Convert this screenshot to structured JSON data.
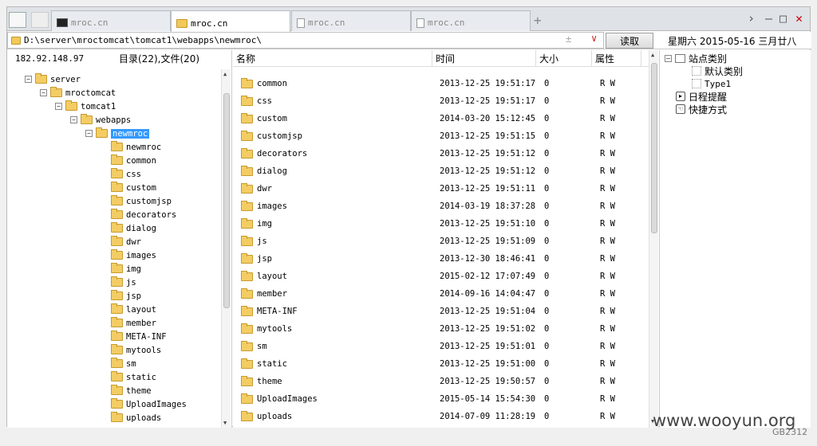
{
  "tabs": [
    {
      "label": "mroc.cn",
      "icon": "terminal-icon",
      "active": false
    },
    {
      "label": "mroc.cn",
      "icon": "folder-icon",
      "active": true
    },
    {
      "label": "mroc.cn",
      "icon": "document-icon",
      "active": false
    },
    {
      "label": "mroc.cn",
      "icon": "document-icon",
      "active": false
    }
  ],
  "address": {
    "path": "D:\\server\\mroctomcat\\tomcat1\\webapps\\newmroc\\",
    "read_label": "读取",
    "date": "星期六 2015-05-16 三月廿八"
  },
  "left": {
    "ip": "182.92.148.97",
    "counts": "目录(22),文件(20)",
    "tree": [
      {
        "label": "server",
        "level": 0,
        "expander": "−"
      },
      {
        "label": "mroctomcat",
        "level": 1,
        "expander": "−"
      },
      {
        "label": "tomcat1",
        "level": 2,
        "expander": "−"
      },
      {
        "label": "webapps",
        "level": 3,
        "expander": "−"
      },
      {
        "label": "newmroc",
        "level": 4,
        "expander": "−",
        "selected": true
      },
      {
        "label": "newmroc",
        "level": 5
      },
      {
        "label": "common",
        "level": 5
      },
      {
        "label": "css",
        "level": 5
      },
      {
        "label": "custom",
        "level": 5
      },
      {
        "label": "customjsp",
        "level": 5
      },
      {
        "label": "decorators",
        "level": 5
      },
      {
        "label": "dialog",
        "level": 5
      },
      {
        "label": "dwr",
        "level": 5
      },
      {
        "label": "images",
        "level": 5
      },
      {
        "label": "img",
        "level": 5
      },
      {
        "label": "js",
        "level": 5
      },
      {
        "label": "jsp",
        "level": 5
      },
      {
        "label": "layout",
        "level": 5
      },
      {
        "label": "member",
        "level": 5
      },
      {
        "label": "META-INF",
        "level": 5
      },
      {
        "label": "mytools",
        "level": 5
      },
      {
        "label": "sm",
        "level": 5
      },
      {
        "label": "static",
        "level": 5
      },
      {
        "label": "theme",
        "level": 5
      },
      {
        "label": "UploadImages",
        "level": 5
      },
      {
        "label": "uploads",
        "level": 5
      }
    ]
  },
  "files": {
    "headers": {
      "name": "名称",
      "time": "时间",
      "size": "大小",
      "attr": "属性"
    },
    "rows": [
      {
        "name": "common",
        "time": "2013-12-25 19:51:17",
        "size": "0",
        "attr": "R W"
      },
      {
        "name": "css",
        "time": "2013-12-25 19:51:17",
        "size": "0",
        "attr": "R W"
      },
      {
        "name": "custom",
        "time": "2014-03-20 15:12:45",
        "size": "0",
        "attr": "R W"
      },
      {
        "name": "customjsp",
        "time": "2013-12-25 19:51:15",
        "size": "0",
        "attr": "R W"
      },
      {
        "name": "decorators",
        "time": "2013-12-25 19:51:12",
        "size": "0",
        "attr": "R W"
      },
      {
        "name": "dialog",
        "time": "2013-12-25 19:51:12",
        "size": "0",
        "attr": "R W"
      },
      {
        "name": "dwr",
        "time": "2013-12-25 19:51:11",
        "size": "0",
        "attr": "R W"
      },
      {
        "name": "images",
        "time": "2014-03-19 18:37:28",
        "size": "0",
        "attr": "R W"
      },
      {
        "name": "img",
        "time": "2013-12-25 19:51:10",
        "size": "0",
        "attr": "R W"
      },
      {
        "name": "js",
        "time": "2013-12-25 19:51:09",
        "size": "0",
        "attr": "R W"
      },
      {
        "name": "jsp",
        "time": "2013-12-30 18:46:41",
        "size": "0",
        "attr": "R W"
      },
      {
        "name": "layout",
        "time": "2015-02-12 17:07:49",
        "size": "0",
        "attr": "R W"
      },
      {
        "name": "member",
        "time": "2014-09-16 14:04:47",
        "size": "0",
        "attr": "R W"
      },
      {
        "name": "META-INF",
        "time": "2013-12-25 19:51:04",
        "size": "0",
        "attr": "R W"
      },
      {
        "name": "mytools",
        "time": "2013-12-25 19:51:02",
        "size": "0",
        "attr": "R W"
      },
      {
        "name": "sm",
        "time": "2013-12-25 19:51:01",
        "size": "0",
        "attr": "R W"
      },
      {
        "name": "static",
        "time": "2013-12-25 19:51:00",
        "size": "0",
        "attr": "R W"
      },
      {
        "name": "theme",
        "time": "2013-12-25 19:50:57",
        "size": "0",
        "attr": "R W"
      },
      {
        "name": "UploadImages",
        "time": "2015-05-14 15:54:30",
        "size": "0",
        "attr": "R W"
      },
      {
        "name": "uploads",
        "time": "2014-07-09 11:28:19",
        "size": "0",
        "attr": "R W"
      }
    ]
  },
  "sidebar": {
    "site_category": "站点类别",
    "default_category": "默认类别",
    "type1": "Type1",
    "schedule": "日程提醒",
    "shortcuts": "快捷方式"
  },
  "watermark": "www.wooyun.org",
  "encoding": "GB2312"
}
